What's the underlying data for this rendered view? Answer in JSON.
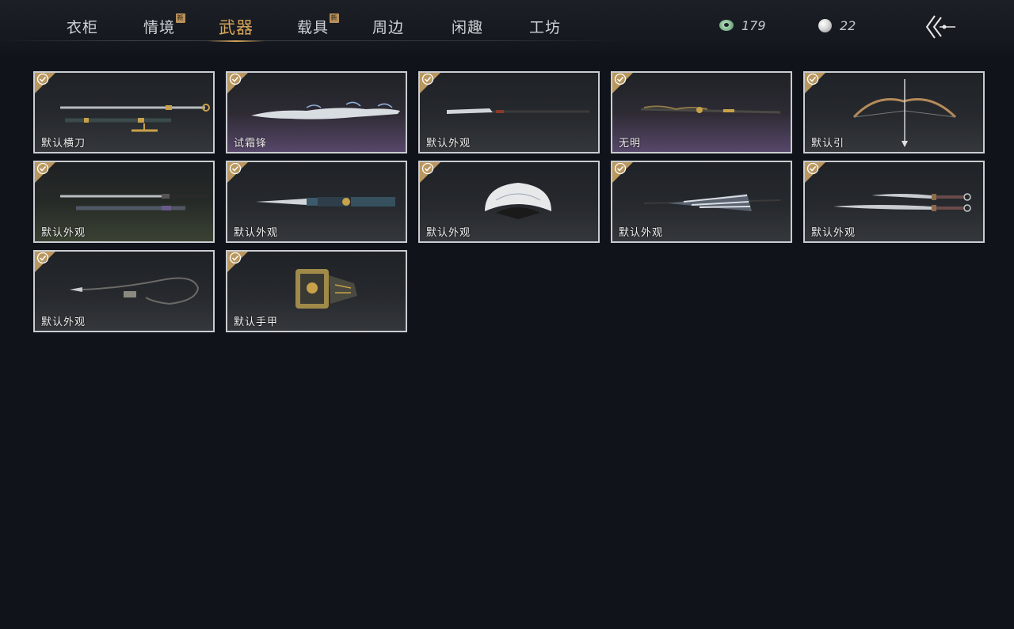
{
  "nav": {
    "tabs": [
      {
        "label": "衣柜"
      },
      {
        "label": "情境",
        "badge": "新"
      },
      {
        "label": "武器"
      },
      {
        "label": "载具",
        "badge": "新"
      },
      {
        "label": "周边"
      },
      {
        "label": "闲趣"
      },
      {
        "label": "工坊"
      }
    ],
    "active_tab": "武器"
  },
  "currencies": [
    {
      "icon": "jade-coin-icon",
      "value": "179"
    },
    {
      "icon": "pearl-icon",
      "value": "22"
    }
  ],
  "back_icon": "back-arrow-icon",
  "colors": {
    "accent": "#d9a55a",
    "check": "#b9975f",
    "card_border": "#c9ccd0",
    "background": "#10141a"
  },
  "items": [
    {
      "name": "默认横刀",
      "art": "sword-pair-icon",
      "owned": true
    },
    {
      "name": "试霜锋",
      "art": "frost-blade-icon",
      "owned": true
    },
    {
      "name": "默认外观",
      "art": "spear-icon",
      "owned": true
    },
    {
      "name": "无明",
      "art": "ornate-staff-icon",
      "owned": true
    },
    {
      "name": "默认引",
      "art": "bow-icon",
      "owned": true
    },
    {
      "name": "默认外观",
      "art": "long-sword-icon",
      "owned": true
    },
    {
      "name": "默认外观",
      "art": "dagger-set-icon",
      "owned": true
    },
    {
      "name": "默认外观",
      "art": "folding-fan-icon",
      "owned": true
    },
    {
      "name": "默认外观",
      "art": "umbrella-icon",
      "owned": true
    },
    {
      "name": "默认外观",
      "art": "twin-sabres-icon",
      "owned": true
    },
    {
      "name": "默认外观",
      "art": "rope-dart-icon",
      "owned": true
    },
    {
      "name": "默认手甲",
      "art": "gauntlet-icon",
      "owned": true
    }
  ]
}
